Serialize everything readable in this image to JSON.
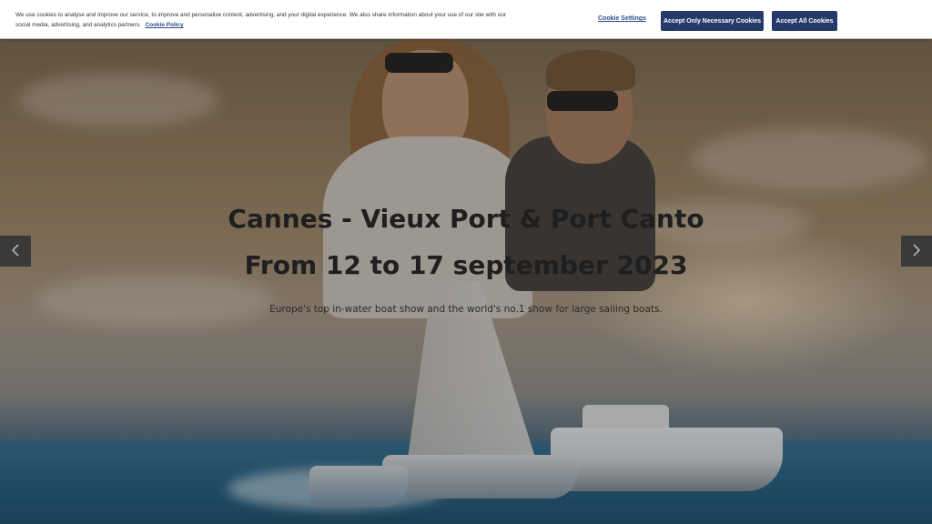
{
  "cookie_banner": {
    "text": "We use cookies to analyse and improve our service, to improve and personalise content, advertising, and your digital experience. We also share information about your use of our site with our social media, advertising, and analytics partners.",
    "policy_link": "Cookie Policy",
    "settings_label": "Cookie Settings",
    "necessary_label": "Accept Only Necessary Cookies",
    "accept_all_label": "Accept All Cookies"
  },
  "hero": {
    "title_line1": "Cannes - Vieux Port & Port Canto",
    "title_line2": "From 12 to 17 september 2023",
    "subtitle": "Europe's top in-water boat show and the world's no.1 show for large sailing boats."
  },
  "carousel": {
    "prev_icon": "chevron-left-icon",
    "next_icon": "chevron-right-icon"
  }
}
